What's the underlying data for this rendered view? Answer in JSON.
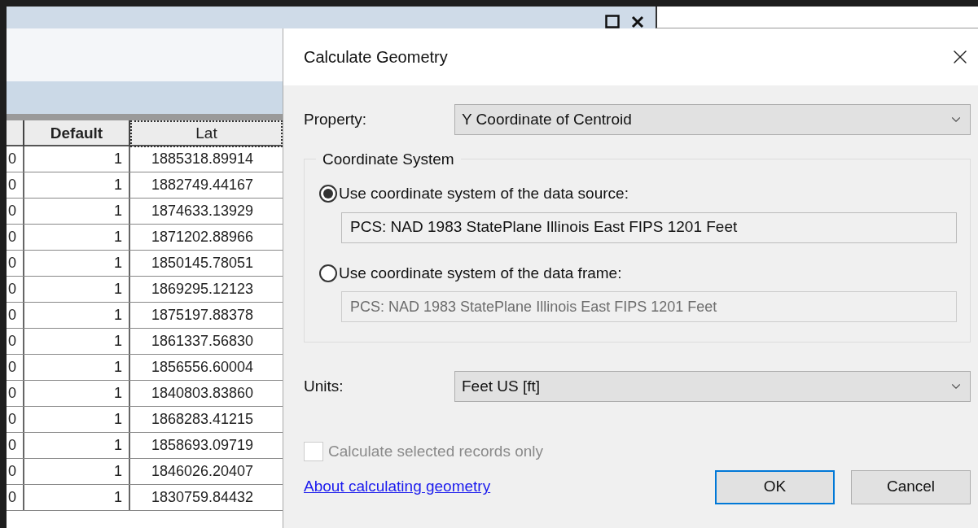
{
  "table": {
    "columns": [
      {
        "label": "Default"
      },
      {
        "label": "Lat"
      }
    ],
    "rows": [
      {
        "column_1": "0",
        "default": "1",
        "lat": "1885318.89914"
      },
      {
        "column_1": "0",
        "default": "1",
        "lat": "1882749.44167"
      },
      {
        "column_1": "0",
        "default": "1",
        "lat": "1874633.13929"
      },
      {
        "column_1": "0",
        "default": "1",
        "lat": "1871202.88966"
      },
      {
        "column_1": "0",
        "default": "1",
        "lat": "1850145.78051"
      },
      {
        "column_1": "0",
        "default": "1",
        "lat": "1869295.12123"
      },
      {
        "column_1": "0",
        "default": "1",
        "lat": "1875197.88378"
      },
      {
        "column_1": "0",
        "default": "1",
        "lat": "1861337.56830"
      },
      {
        "column_1": "0",
        "default": "1",
        "lat": "1856556.60004"
      },
      {
        "column_1": "0",
        "default": "1",
        "lat": "1840803.83860"
      },
      {
        "column_1": "0",
        "default": "1",
        "lat": "1868283.41215"
      },
      {
        "column_1": "0",
        "default": "1",
        "lat": "1858693.09719"
      },
      {
        "column_1": "0",
        "default": "1",
        "lat": "1846026.20407"
      },
      {
        "column_1": "0",
        "default": "1",
        "lat": "1830759.84432"
      }
    ]
  },
  "dialog": {
    "title": "Calculate Geometry",
    "property": {
      "label": "Property:",
      "value": "Y Coordinate of Centroid"
    },
    "coordinate_system": {
      "title": "Coordinate System",
      "options": [
        {
          "label": "Use coordinate system of the data source:",
          "selected": true,
          "value": "PCS: NAD 1983 StatePlane Illinois East FIPS 1201 Feet",
          "disabled": false
        },
        {
          "label": "Use coordinate system of the data frame:",
          "selected": false,
          "value": "PCS: NAD 1983 StatePlane Illinois East FIPS 1201 Feet",
          "disabled": true
        }
      ]
    },
    "units": {
      "label": "Units:",
      "value": "Feet US [ft]"
    },
    "selected_only": {
      "label": "Calculate selected records only",
      "checked": false,
      "disabled": true
    },
    "help_link": "About calculating geometry",
    "buttons": [
      {
        "label": "OK",
        "default": true
      },
      {
        "label": "Cancel",
        "default": false
      }
    ]
  }
}
